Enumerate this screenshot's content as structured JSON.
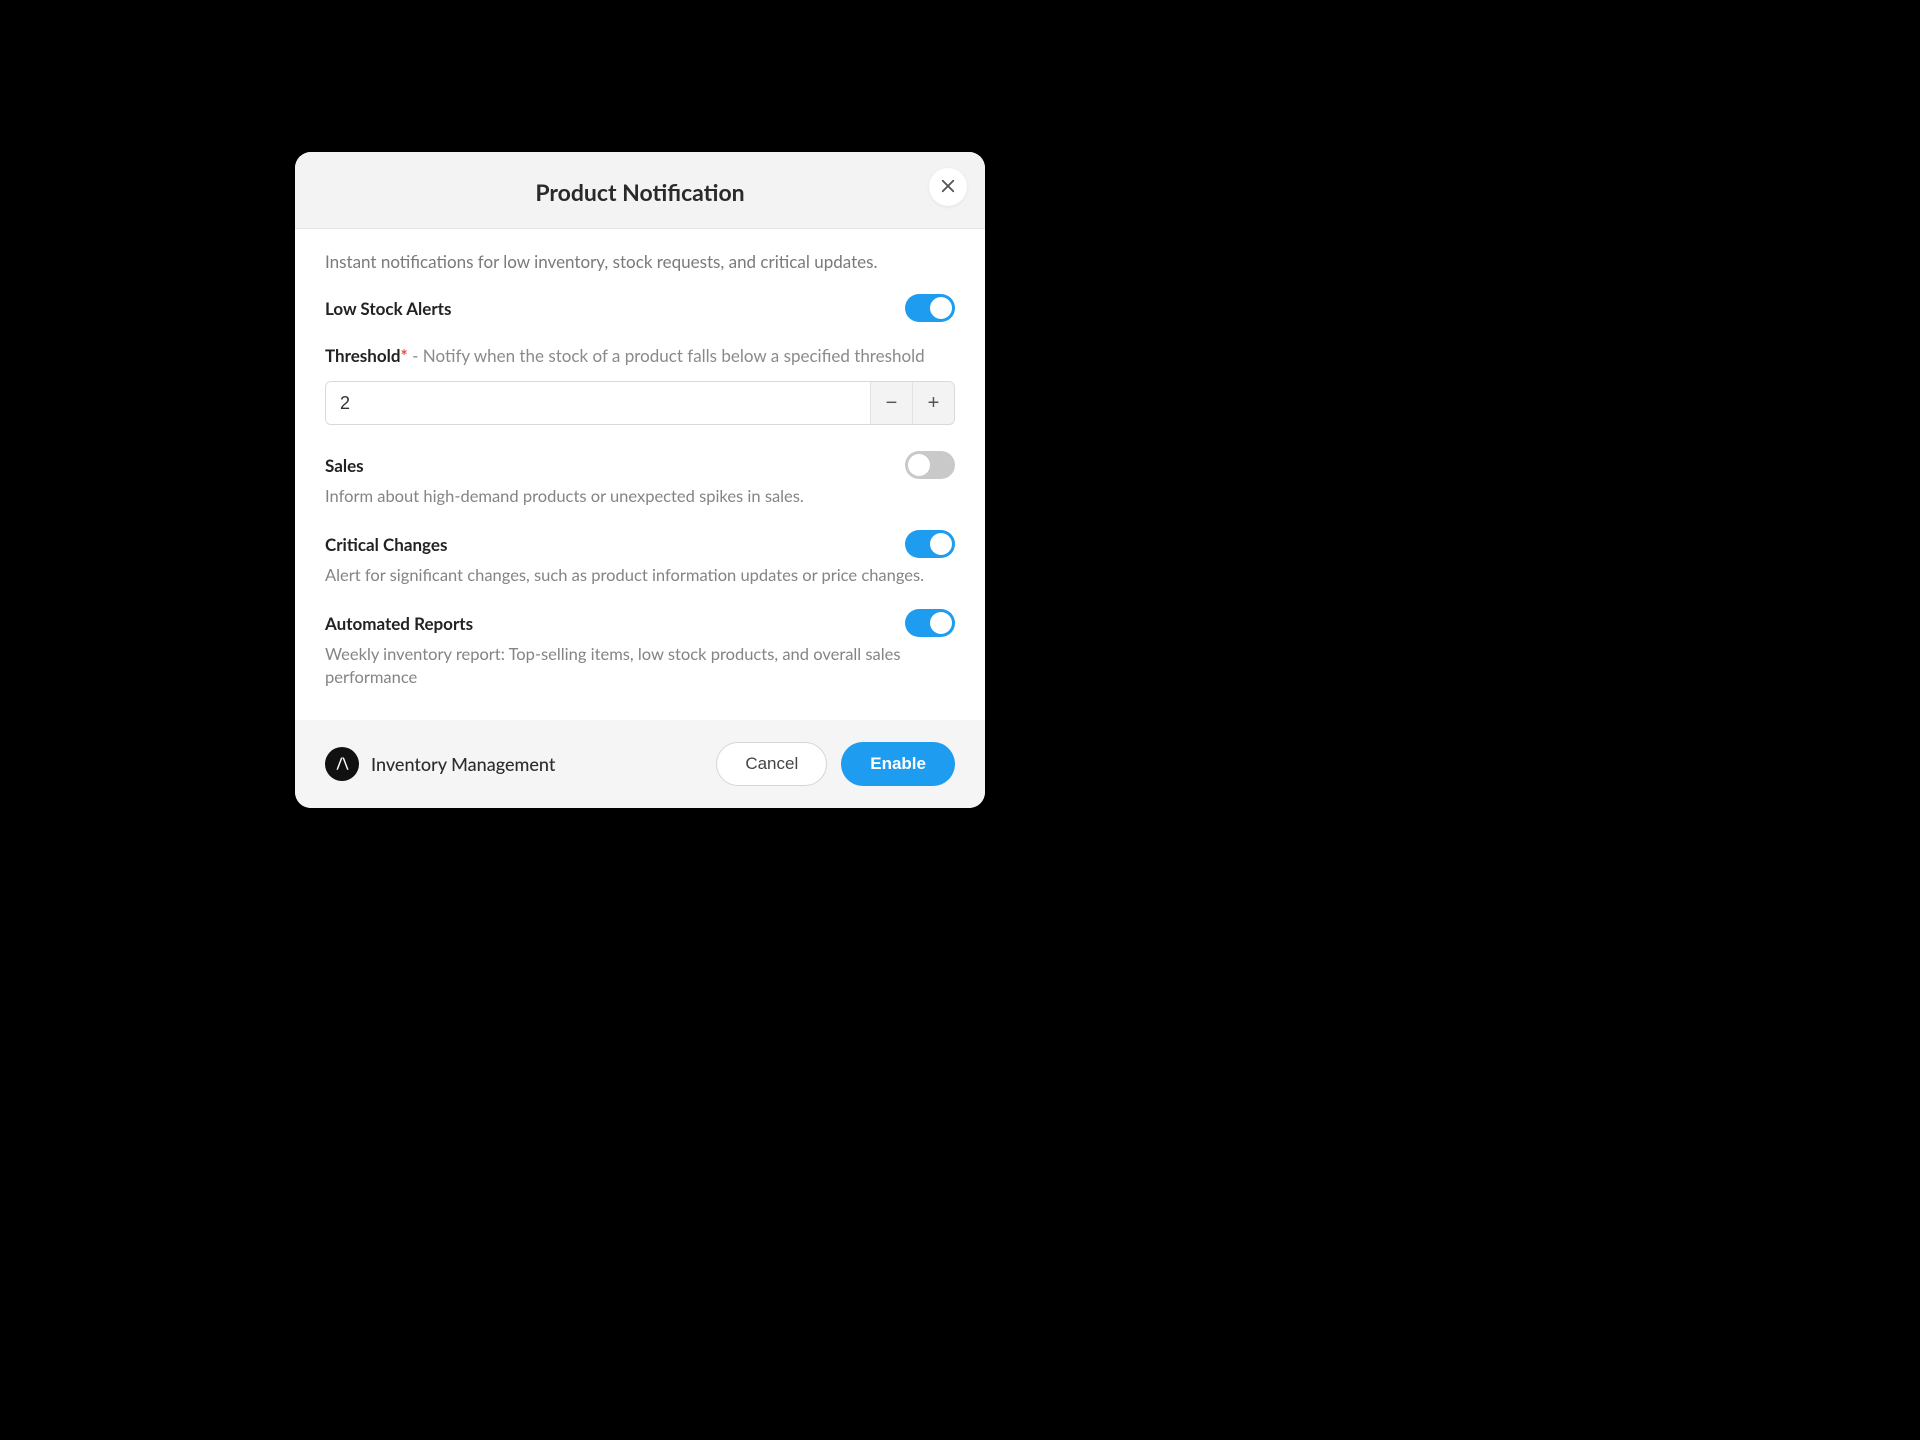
{
  "modal": {
    "title": "Product Notification",
    "intro": "Instant notifications for low inventory, stock requests, and critical updates.",
    "threshold": {
      "label": "Threshold",
      "required_mark": "*",
      "separator": "  -  ",
      "hint": "Notify when the stock of a product falls below a specified threshold",
      "value": "2"
    },
    "settings": {
      "low_stock": {
        "label": "Low Stock Alerts",
        "enabled": true
      },
      "sales": {
        "label": "Sales",
        "desc": "Inform about high-demand products or unexpected spikes in sales.",
        "enabled": false
      },
      "critical": {
        "label": "Critical Changes",
        "desc": "Alert for significant changes, such as product information updates or price changes.",
        "enabled": true
      },
      "reports": {
        "label": "Automated Reports",
        "desc": "Weekly inventory report: Top-selling items, low stock products, and overall sales performance",
        "enabled": true
      }
    },
    "footer": {
      "brand_mark": "/\\",
      "brand_name": "Inventory Management",
      "cancel": "Cancel",
      "enable": "Enable"
    }
  }
}
